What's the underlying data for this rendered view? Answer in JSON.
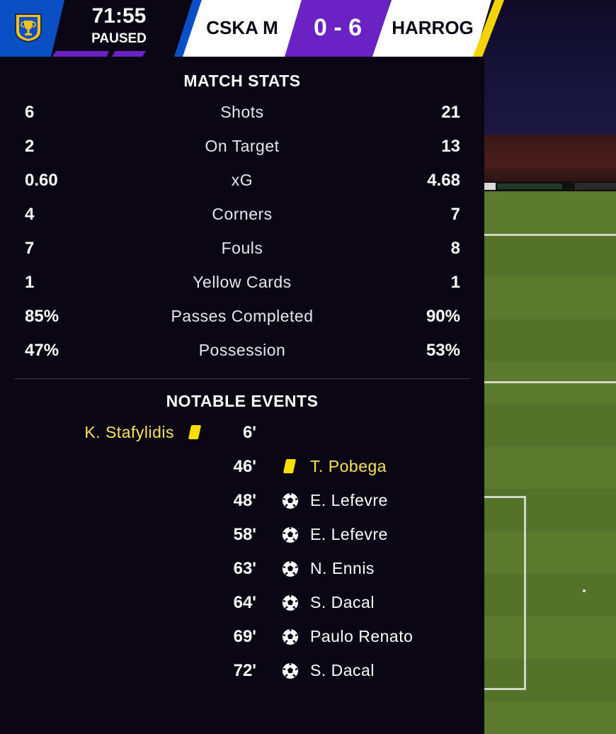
{
  "scoreboard": {
    "competition_icon": "trophy-icon",
    "clock": "71:55",
    "status": "PAUSED",
    "home_team": "CSKA M",
    "away_team": "HARROG",
    "score": "0 - 6",
    "colors": {
      "home": "#0a4fc4",
      "away": "#f2d400",
      "score_bg": "#6a22c4"
    }
  },
  "match_stats": {
    "title": "MATCH STATS",
    "rows": [
      {
        "home": "6",
        "label": "Shots",
        "away": "21"
      },
      {
        "home": "2",
        "label": "On Target",
        "away": "13"
      },
      {
        "home": "0.60",
        "label": "xG",
        "away": "4.68"
      },
      {
        "home": "4",
        "label": "Corners",
        "away": "7"
      },
      {
        "home": "7",
        "label": "Fouls",
        "away": "8"
      },
      {
        "home": "1",
        "label": "Yellow Cards",
        "away": "1"
      },
      {
        "home": "85%",
        "label": "Passes Completed",
        "away": "90%"
      },
      {
        "home": "47%",
        "label": "Possession",
        "away": "53%"
      }
    ]
  },
  "notable_events": {
    "title": "NOTABLE EVENTS",
    "events": [
      {
        "minute": "6'",
        "side": "home",
        "type": "yellow-card-icon",
        "player": "K. Stafylidis",
        "color": "#f7e35a"
      },
      {
        "minute": "46'",
        "side": "away",
        "type": "yellow-card-icon",
        "player": "T. Pobega",
        "color": "#f7e35a"
      },
      {
        "minute": "48'",
        "side": "away",
        "type": "goal-ball-icon",
        "player": "E. Lefevre",
        "color": "#ffffff"
      },
      {
        "minute": "58'",
        "side": "away",
        "type": "goal-ball-icon",
        "player": "E. Lefevre",
        "color": "#ffffff"
      },
      {
        "minute": "63'",
        "side": "away",
        "type": "goal-ball-icon",
        "player": "N. Ennis",
        "color": "#ffffff"
      },
      {
        "minute": "64'",
        "side": "away",
        "type": "goal-ball-icon",
        "player": "S. Dacal",
        "color": "#ffffff"
      },
      {
        "minute": "69'",
        "side": "away",
        "type": "goal-ball-icon",
        "player": "Paulo Renato",
        "color": "#ffffff"
      },
      {
        "minute": "72'",
        "side": "away",
        "type": "goal-ball-icon",
        "player": "S. Dacal",
        "color": "#ffffff"
      }
    ]
  }
}
